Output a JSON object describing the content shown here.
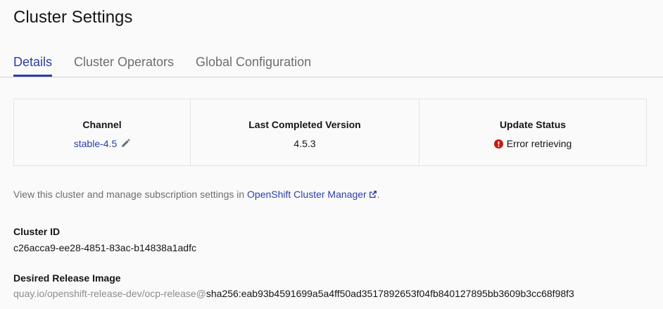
{
  "page": {
    "title": "Cluster Settings"
  },
  "tabs": [
    {
      "label": "Details",
      "active": true
    },
    {
      "label": "Cluster Operators",
      "active": false
    },
    {
      "label": "Global Configuration",
      "active": false
    }
  ],
  "status_card": {
    "channel": {
      "heading": "Channel",
      "value": "stable-4.5",
      "icon": "pencil-icon"
    },
    "version": {
      "heading": "Last Completed Version",
      "value": "4.5.3"
    },
    "update": {
      "heading": "Update Status",
      "value": "Error retrieving",
      "icon": "error-circle-icon",
      "color": "#c9190b"
    }
  },
  "info": {
    "prefix": "View this cluster and manage subscription settings in ",
    "link_text": "OpenShift Cluster Manager",
    "suffix": ".",
    "icon": "external-link-icon"
  },
  "cluster_id": {
    "label": "Cluster ID",
    "value": "c26acca9-ee28-4851-83ac-b14838a1adfc"
  },
  "release_image": {
    "label": "Desired Release Image",
    "repo": "quay.io/openshift-release-dev/ocp-release@",
    "digest": "sha256:eab93b4591699a5a4ff50ad3517892653f04fb840127895bb3609b3cc68f98f3"
  },
  "colors": {
    "accent": "#2b3fa8",
    "error": "#c9190b",
    "muted": "#6a6e73",
    "border": "#d2d2d2"
  }
}
